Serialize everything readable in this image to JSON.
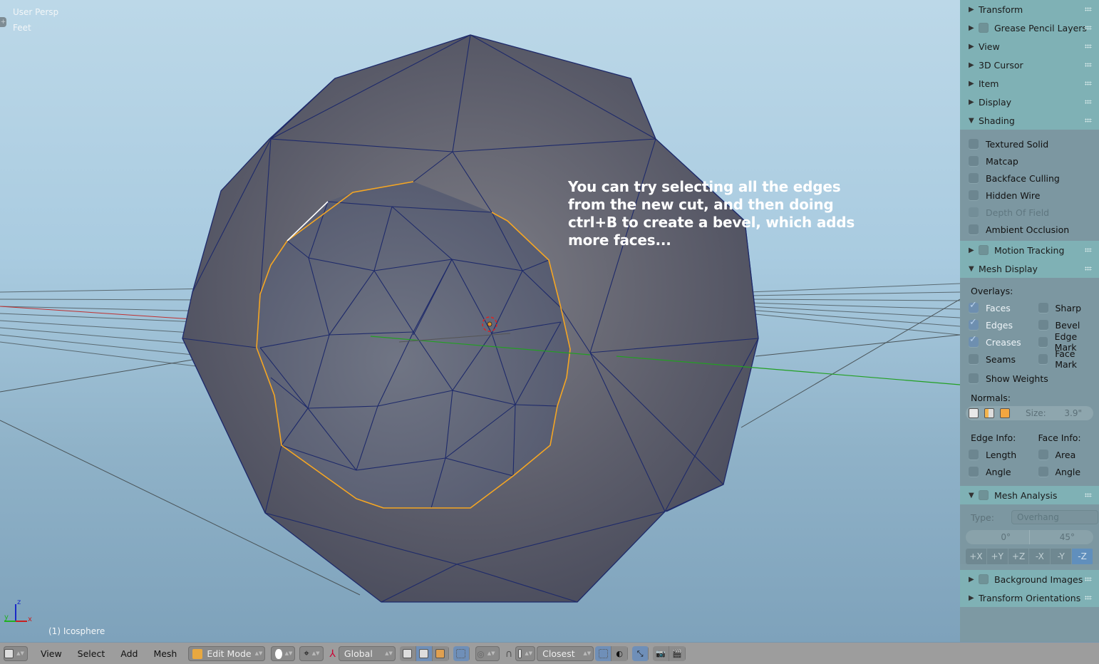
{
  "viewport": {
    "view_label": "User Persp",
    "units_label": "Feet",
    "object_label": "(1) Icosphere",
    "annotation": "You can try selecting all the edges from the new cut, and then doing ctrl+B to create a bevel, which adds more faces...",
    "axis_labels": {
      "x": "x",
      "y": "y",
      "z": "z"
    },
    "colors": {
      "mesh_edge": "#1e2a6a",
      "selected_edge": "#f5a623",
      "active_edge": "#ffffff",
      "x_axis": "#c03030",
      "y_axis": "#22a022"
    }
  },
  "panel": {
    "sections": [
      {
        "label": "Transform",
        "expanded": false
      },
      {
        "label": "Grease Pencil Layers",
        "expanded": false,
        "has_checkbox": true
      },
      {
        "label": "View",
        "expanded": false
      },
      {
        "label": "3D Cursor",
        "expanded": false
      },
      {
        "label": "Item",
        "expanded": false
      },
      {
        "label": "Display",
        "expanded": false
      },
      {
        "label": "Shading",
        "expanded": true
      },
      {
        "label": "Motion Tracking",
        "expanded": false,
        "has_checkbox": true
      },
      {
        "label": "Mesh Display",
        "expanded": true
      },
      {
        "label": "Mesh Analysis",
        "expanded": true,
        "has_checkbox": true
      },
      {
        "label": "Background Images",
        "expanded": false,
        "has_checkbox": true
      },
      {
        "label": "Transform Orientations",
        "expanded": false
      }
    ],
    "shading": [
      {
        "label": "Textured Solid",
        "checked": false
      },
      {
        "label": "Matcap",
        "checked": false
      },
      {
        "label": "Backface Culling",
        "checked": false
      },
      {
        "label": "Hidden Wire",
        "checked": false
      },
      {
        "label": "Depth Of Field",
        "checked": false,
        "disabled": true
      },
      {
        "label": "Ambient Occlusion",
        "checked": false
      }
    ],
    "mesh_display": {
      "overlays_label": "Overlays:",
      "overlays_left": [
        {
          "label": "Faces",
          "checked": true
        },
        {
          "label": "Edges",
          "checked": true
        },
        {
          "label": "Creases",
          "checked": true
        },
        {
          "label": "Seams",
          "checked": false
        }
      ],
      "overlays_right": [
        {
          "label": "Sharp",
          "checked": false
        },
        {
          "label": "Bevel",
          "checked": false
        },
        {
          "label": "Edge Mark",
          "checked": false
        },
        {
          "label": "Face Mark",
          "checked": false
        }
      ],
      "show_weights": {
        "label": "Show Weights",
        "checked": false
      },
      "normals_label": "Normals:",
      "normals_size_label": "Size:",
      "normals_size_value": "3.9\"",
      "edge_info_label": "Edge Info:",
      "face_info_label": "Face Info:",
      "edge_info": [
        {
          "label": "Length",
          "checked": false
        },
        {
          "label": "Angle",
          "checked": false
        }
      ],
      "face_info": [
        {
          "label": "Area",
          "checked": false
        },
        {
          "label": "Angle",
          "checked": false
        }
      ]
    },
    "mesh_analysis": {
      "type_label": "Type:",
      "type_value": "Overhang",
      "range_min": "0°",
      "range_max": "45°",
      "axes": [
        "+X",
        "+Y",
        "+Z",
        "-X",
        "-Y",
        "-Z"
      ],
      "active_axis": "-Z"
    }
  },
  "footer": {
    "menus": [
      "View",
      "Select",
      "Add",
      "Mesh"
    ],
    "mode": "Edit Mode",
    "orientation": "Global",
    "snap_target": "Closest"
  }
}
